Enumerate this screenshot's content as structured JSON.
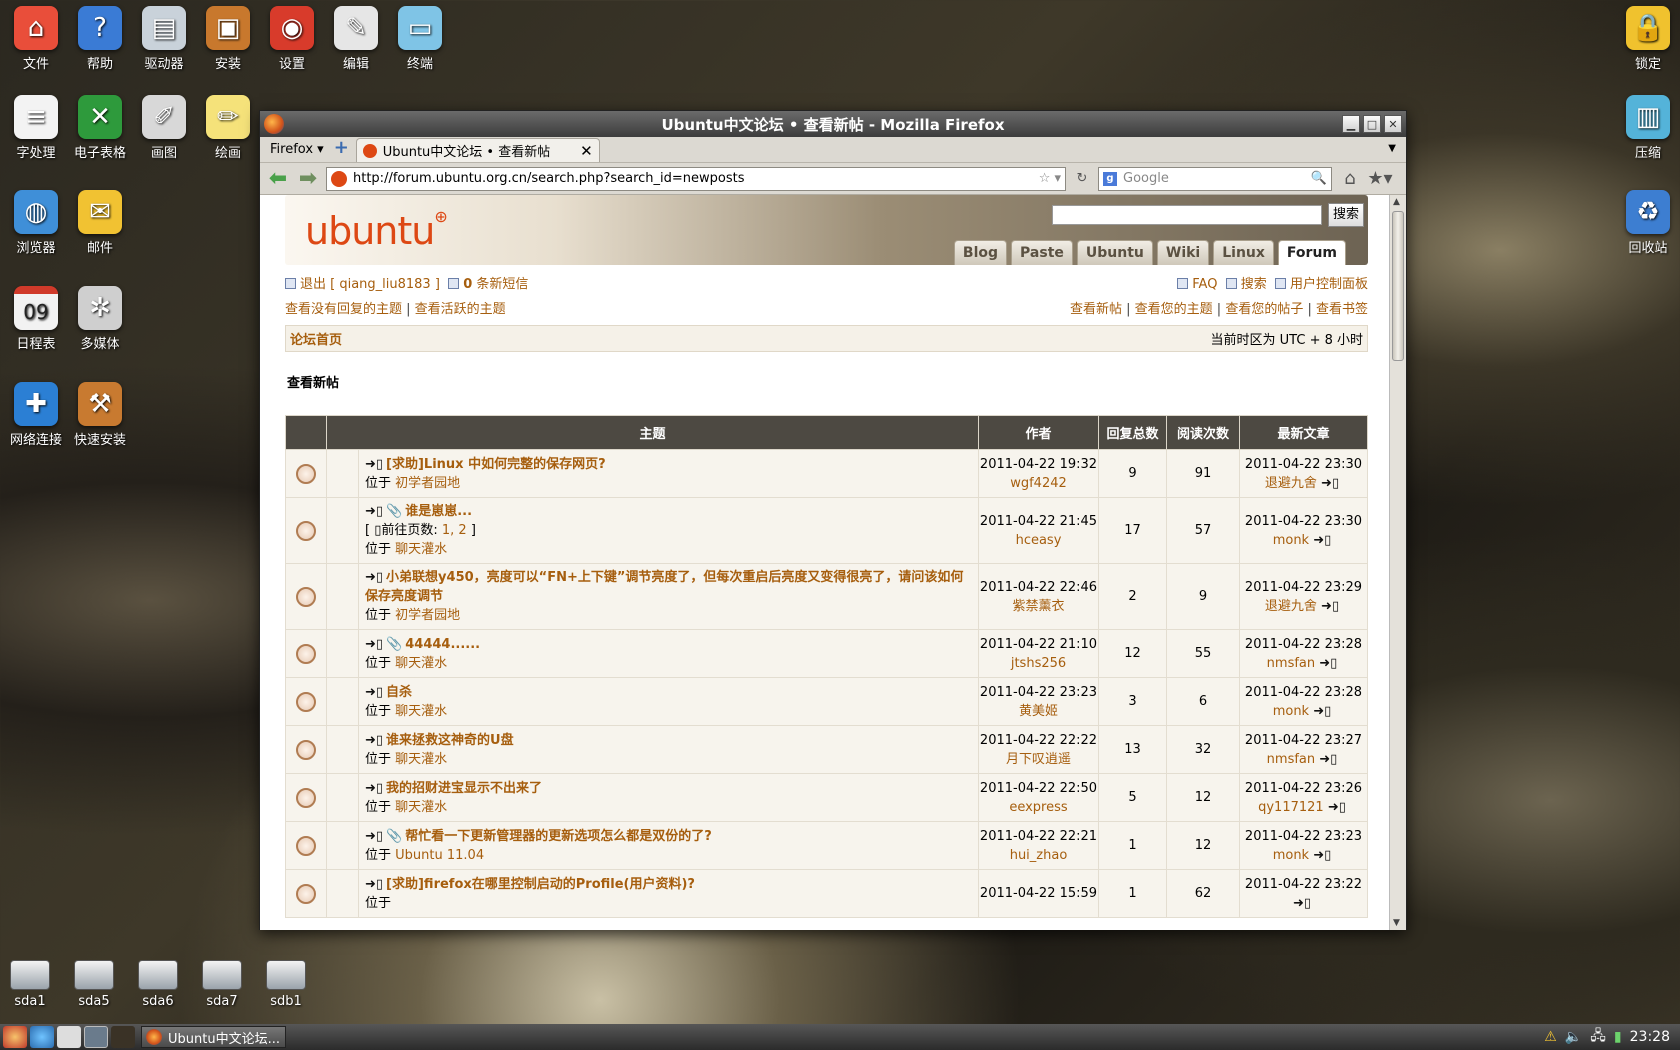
{
  "desktop": {
    "icons_left": [
      {
        "label": "文件",
        "icon": "home-icon",
        "color": "#e94e3a"
      },
      {
        "label": "帮助",
        "icon": "help-icon",
        "color": "#3a7bd5"
      },
      {
        "label": "驱动器",
        "icon": "drive-icon",
        "color": "#c9d2da"
      },
      {
        "label": "安装",
        "icon": "briefcase-icon",
        "color": "#c8782d"
      },
      {
        "label": "设置",
        "icon": "settings-icon",
        "color": "#d83b2b"
      },
      {
        "label": "编辑",
        "icon": "edit-icon",
        "color": "#e6e6e6"
      },
      {
        "label": "终端",
        "icon": "terminal-icon",
        "color": "#7fc4e6"
      },
      {
        "label": "字处理",
        "icon": "document-icon",
        "color": "#f3f3f3"
      },
      {
        "label": "电子表格",
        "icon": "spreadsheet-icon",
        "color": "#2e9a3c"
      },
      {
        "label": "画图",
        "icon": "paint-icon",
        "color": "#d8d8d8"
      },
      {
        "label": "绘画",
        "icon": "draw-icon",
        "color": "#f5e27a"
      },
      {
        "label": "浏览器",
        "icon": "globe-icon",
        "color": "#3f8fd8"
      },
      {
        "label": "邮件",
        "icon": "mail-icon",
        "color": "#f1c232"
      },
      {
        "label": "日程表",
        "icon": "calendar-icon",
        "color": "#f2f2f2"
      },
      {
        "label": "多媒体",
        "icon": "film-reel-icon",
        "color": "#cfcfcf"
      },
      {
        "label": "网络连接",
        "icon": "network-icon",
        "color": "#2b7fd4"
      },
      {
        "label": "快速安装",
        "icon": "toolbox-icon",
        "color": "#c87a30"
      }
    ],
    "icons_right": [
      {
        "label": "锁定",
        "icon": "lock-icon",
        "color": "#f0c22e"
      },
      {
        "label": "压缩",
        "icon": "archive-icon",
        "color": "#54b3d9"
      },
      {
        "label": "回收站",
        "icon": "trash-icon",
        "color": "#3d7ed1"
      }
    ],
    "drives": [
      "sda1",
      "sda5",
      "sda6",
      "sda7",
      "sdb1"
    ],
    "calendar_day": "09"
  },
  "window": {
    "title": "Ubuntu中文论坛 • 查看新帖 - Mozilla Firefox",
    "menu_label": "Firefox",
    "tab_label": "Ubuntu中文论坛 • 查看新帖",
    "url": "http://forum.ubuntu.org.cn/search.php?search_id=newposts",
    "search_placeholder": "Google"
  },
  "page": {
    "logo": "ubuntu",
    "search_button": "搜索",
    "nav_tabs": [
      "Blog",
      "Paste",
      "Ubuntu",
      "Wiki",
      "Linux",
      "Forum"
    ],
    "logout": "退出 [ qiang_liu8183 ]",
    "messages_count": "0",
    "messages_label": "条新短信",
    "faq": "FAQ",
    "search": "搜索",
    "ucp": "用户控制面板",
    "unanswered": "查看没有回复的主题",
    "active": "查看活跃的主题",
    "new_posts": "查看新帖",
    "your_topics": "查看您的主题",
    "your_posts": "查看您的帖子",
    "bookmarks": "查看书签",
    "forum_index": "论坛首页",
    "timezone": "当前时区为 UTC + 8 小时",
    "heading": "查看新帖",
    "columns": [
      "主题",
      "作者",
      "回复总数",
      "阅读次数",
      "最新文章"
    ],
    "location_prefix": "位于",
    "goto_page": "前往页数:",
    "topics": [
      {
        "title": "[求助]Linux 中如何完整的保存网页?",
        "forum": "初学者园地",
        "date": "2011-04-22 19:32",
        "author": "wgf4242",
        "replies": "9",
        "views": "91",
        "last_date": "2011-04-22 23:30",
        "last_author": "退避九舍",
        "attach": false,
        "pages": ""
      },
      {
        "title": "谁是崽崽...",
        "forum": "聊天灌水",
        "date": "2011-04-22 21:45",
        "author": "hceasy",
        "replies": "17",
        "views": "57",
        "last_date": "2011-04-22 23:30",
        "last_author": "monk",
        "attach": true,
        "pages": "1, 2"
      },
      {
        "title": "小弟联想y450，亮度可以“FN+上下键”调节亮度了，但每次重启后亮度又变得很亮了，请问该如何保存亮度调节",
        "forum": "初学者园地",
        "date": "2011-04-22 22:46",
        "author": "紫禁薰衣",
        "replies": "2",
        "views": "9",
        "last_date": "2011-04-22 23:29",
        "last_author": "退避九舍",
        "attach": false,
        "pages": ""
      },
      {
        "title": "44444......",
        "forum": "聊天灌水",
        "date": "2011-04-22 21:10",
        "author": "jtshs256",
        "replies": "12",
        "views": "55",
        "last_date": "2011-04-22 23:28",
        "last_author": "nmsfan",
        "attach": true,
        "pages": ""
      },
      {
        "title": "自杀",
        "forum": "聊天灌水",
        "date": "2011-04-22 23:23",
        "author": "黄美姬",
        "replies": "3",
        "views": "6",
        "last_date": "2011-04-22 23:28",
        "last_author": "monk",
        "attach": false,
        "pages": ""
      },
      {
        "title": "谁来拯救这神奇的U盘",
        "forum": "聊天灌水",
        "date": "2011-04-22 22:22",
        "author": "月下叹逍遥",
        "replies": "13",
        "views": "32",
        "last_date": "2011-04-22 23:27",
        "last_author": "nmsfan",
        "attach": false,
        "pages": ""
      },
      {
        "title": "我的招财进宝显示不出来了",
        "forum": "聊天灌水",
        "date": "2011-04-22 22:50",
        "author": "eexpress",
        "replies": "5",
        "views": "12",
        "last_date": "2011-04-22 23:26",
        "last_author": "qy117121",
        "attach": false,
        "pages": ""
      },
      {
        "title": "帮忙看一下更新管理器的更新选项怎么都是双份的了?",
        "forum": "Ubuntu 11.04",
        "date": "2011-04-22 22:21",
        "author": "hui_zhao",
        "replies": "1",
        "views": "12",
        "last_date": "2011-04-22 23:23",
        "last_author": "monk",
        "attach": true,
        "pages": ""
      },
      {
        "title": "[求助]firefox在哪里控制启动的Profile(用户资料)?",
        "forum": "",
        "date": "2011-04-22 15:59",
        "author": "",
        "replies": "1",
        "views": "62",
        "last_date": "2011-04-22 23:22",
        "last_author": "",
        "attach": false,
        "pages": ""
      }
    ]
  },
  "taskbar": {
    "window_label": "Ubuntu中文论坛...",
    "clock": "23:28"
  }
}
